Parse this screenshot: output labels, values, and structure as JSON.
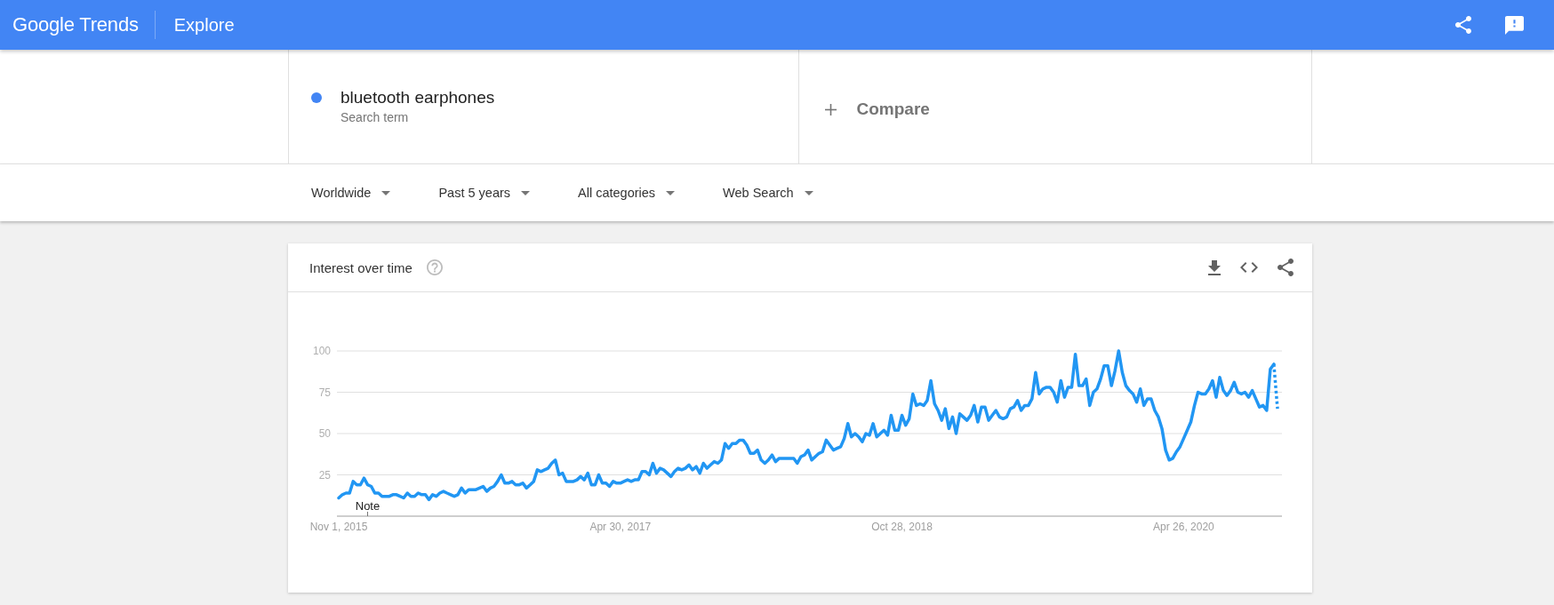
{
  "header": {
    "logo": "Google Trends",
    "page": "Explore"
  },
  "search": {
    "terms": [
      {
        "label": "bluetooth earphones",
        "caption": "Search term",
        "color": "#4285f4"
      }
    ],
    "compare": {
      "label": "Compare"
    }
  },
  "filters": [
    {
      "label": "Worldwide"
    },
    {
      "label": "Past 5 years"
    },
    {
      "label": "All categories"
    },
    {
      "label": "Web Search"
    }
  ],
  "interest_card": {
    "title": "Interest over time",
    "chart_data": {
      "type": "line",
      "grid": true,
      "categories": [
        "Nov 1, 2015",
        null,
        null,
        null,
        null,
        null,
        null,
        null,
        null,
        null,
        null,
        null,
        null,
        null,
        null,
        null,
        null,
        null,
        null,
        null,
        null,
        null,
        null,
        null,
        null,
        null,
        null,
        null,
        null,
        null,
        null,
        null,
        null,
        null,
        null,
        null,
        null,
        null,
        null,
        null,
        null,
        null,
        null,
        null,
        null,
        null,
        null,
        null,
        null,
        null,
        null,
        null,
        null,
        null,
        null,
        null,
        null,
        null,
        null,
        null,
        null,
        null,
        null,
        null,
        null,
        null,
        null,
        null,
        null,
        null,
        null,
        null,
        null,
        null,
        null,
        null,
        null,
        null,
        "Apr 30, 2017",
        null,
        null,
        null,
        null,
        null,
        null,
        null,
        null,
        null,
        null,
        null,
        null,
        null,
        null,
        null,
        null,
        null,
        null,
        null,
        null,
        null,
        null,
        null,
        null,
        null,
        null,
        null,
        null,
        null,
        null,
        null,
        null,
        null,
        null,
        null,
        null,
        null,
        null,
        null,
        null,
        null,
        null,
        null,
        null,
        null,
        null,
        null,
        null,
        null,
        null,
        null,
        null,
        null,
        null,
        null,
        null,
        null,
        null,
        null,
        null,
        null,
        null,
        null,
        null,
        null,
        null,
        null,
        null,
        null,
        null,
        null,
        null,
        null,
        null,
        null,
        null,
        null,
        "Oct 28, 2018",
        null,
        null,
        null,
        null,
        null,
        null,
        null,
        null,
        null,
        null,
        null,
        null,
        null,
        null,
        null,
        null,
        null,
        null,
        null,
        null,
        null,
        null,
        null,
        null,
        null,
        null,
        null,
        null,
        null,
        null,
        null,
        null,
        null,
        null,
        null,
        null,
        null,
        null,
        null,
        null,
        null,
        null,
        null,
        null,
        null,
        null,
        null,
        null,
        null,
        null,
        null,
        null,
        null,
        null,
        null,
        null,
        null,
        null,
        null,
        null,
        null,
        null,
        null,
        null,
        null,
        null,
        null,
        null,
        null,
        null,
        null,
        null,
        null,
        null,
        null,
        null,
        null,
        "Apr 26, 2020",
        null,
        null,
        null,
        null,
        null,
        null,
        null,
        null,
        null,
        null,
        null,
        null,
        null,
        null,
        null,
        null,
        null,
        null,
        null,
        null,
        null,
        null,
        null,
        null,
        null,
        null
      ],
      "series": [
        {
          "color": "#2196f3",
          "values": [
            11,
            13,
            14,
            14,
            21,
            19,
            19,
            23,
            19,
            18,
            14,
            14,
            12,
            12,
            12,
            13,
            13,
            12,
            11,
            14,
            12,
            12,
            14,
            13,
            13,
            10,
            13,
            12,
            14,
            15,
            14,
            13,
            12,
            13,
            17,
            14,
            16,
            16,
            16,
            17,
            18,
            15,
            17,
            18,
            21,
            25,
            20,
            20,
            21,
            19,
            19,
            20,
            17,
            19,
            21,
            28,
            27,
            28,
            29,
            32,
            34,
            25,
            26,
            21,
            21,
            21,
            22,
            24,
            22,
            26,
            19,
            19,
            25,
            20,
            20,
            18,
            21,
            20,
            20,
            21,
            22,
            21,
            22,
            22,
            27,
            27,
            25,
            32,
            26,
            29,
            28,
            26,
            24,
            27,
            29,
            28,
            29,
            31,
            28,
            30,
            26,
            32,
            29,
            31,
            33,
            32,
            34,
            44,
            41,
            44,
            44,
            46,
            46,
            43,
            38,
            38,
            40,
            34,
            32,
            34,
            37,
            33,
            35,
            35,
            35,
            35,
            35,
            32,
            36,
            37,
            40,
            34,
            36,
            38,
            39,
            46,
            43,
            40,
            41,
            42,
            47,
            56,
            48,
            50,
            48,
            45,
            50,
            49,
            56,
            48,
            50,
            52,
            49,
            61,
            52,
            52,
            61,
            55,
            59,
            74,
            67,
            68,
            67,
            70,
            82,
            68,
            64,
            58,
            65,
            53,
            60,
            50,
            62,
            60,
            58,
            61,
            67,
            57,
            66,
            66,
            58,
            61,
            64,
            60,
            59,
            60,
            65,
            66,
            70,
            64,
            67,
            67,
            71,
            87,
            74,
            77,
            78,
            78,
            75,
            69,
            82,
            72,
            78,
            78,
            98,
            79,
            79,
            83,
            67,
            75,
            77,
            83,
            91,
            91,
            79,
            88,
            100,
            87,
            79,
            76,
            74,
            69,
            77,
            67,
            71,
            71,
            64,
            60,
            53,
            40,
            34,
            35,
            39,
            42,
            47,
            52,
            57,
            67,
            75,
            74,
            74,
            77,
            82,
            72,
            84,
            76,
            73,
            76,
            81,
            75,
            74,
            75,
            72,
            76,
            71,
            66,
            67,
            64,
            89,
            92,
            65
          ]
        }
      ],
      "ylim": [
        0,
        100
      ],
      "yticks": [
        25,
        50,
        75,
        100
      ],
      "annotations": [
        "Note"
      ]
    }
  }
}
